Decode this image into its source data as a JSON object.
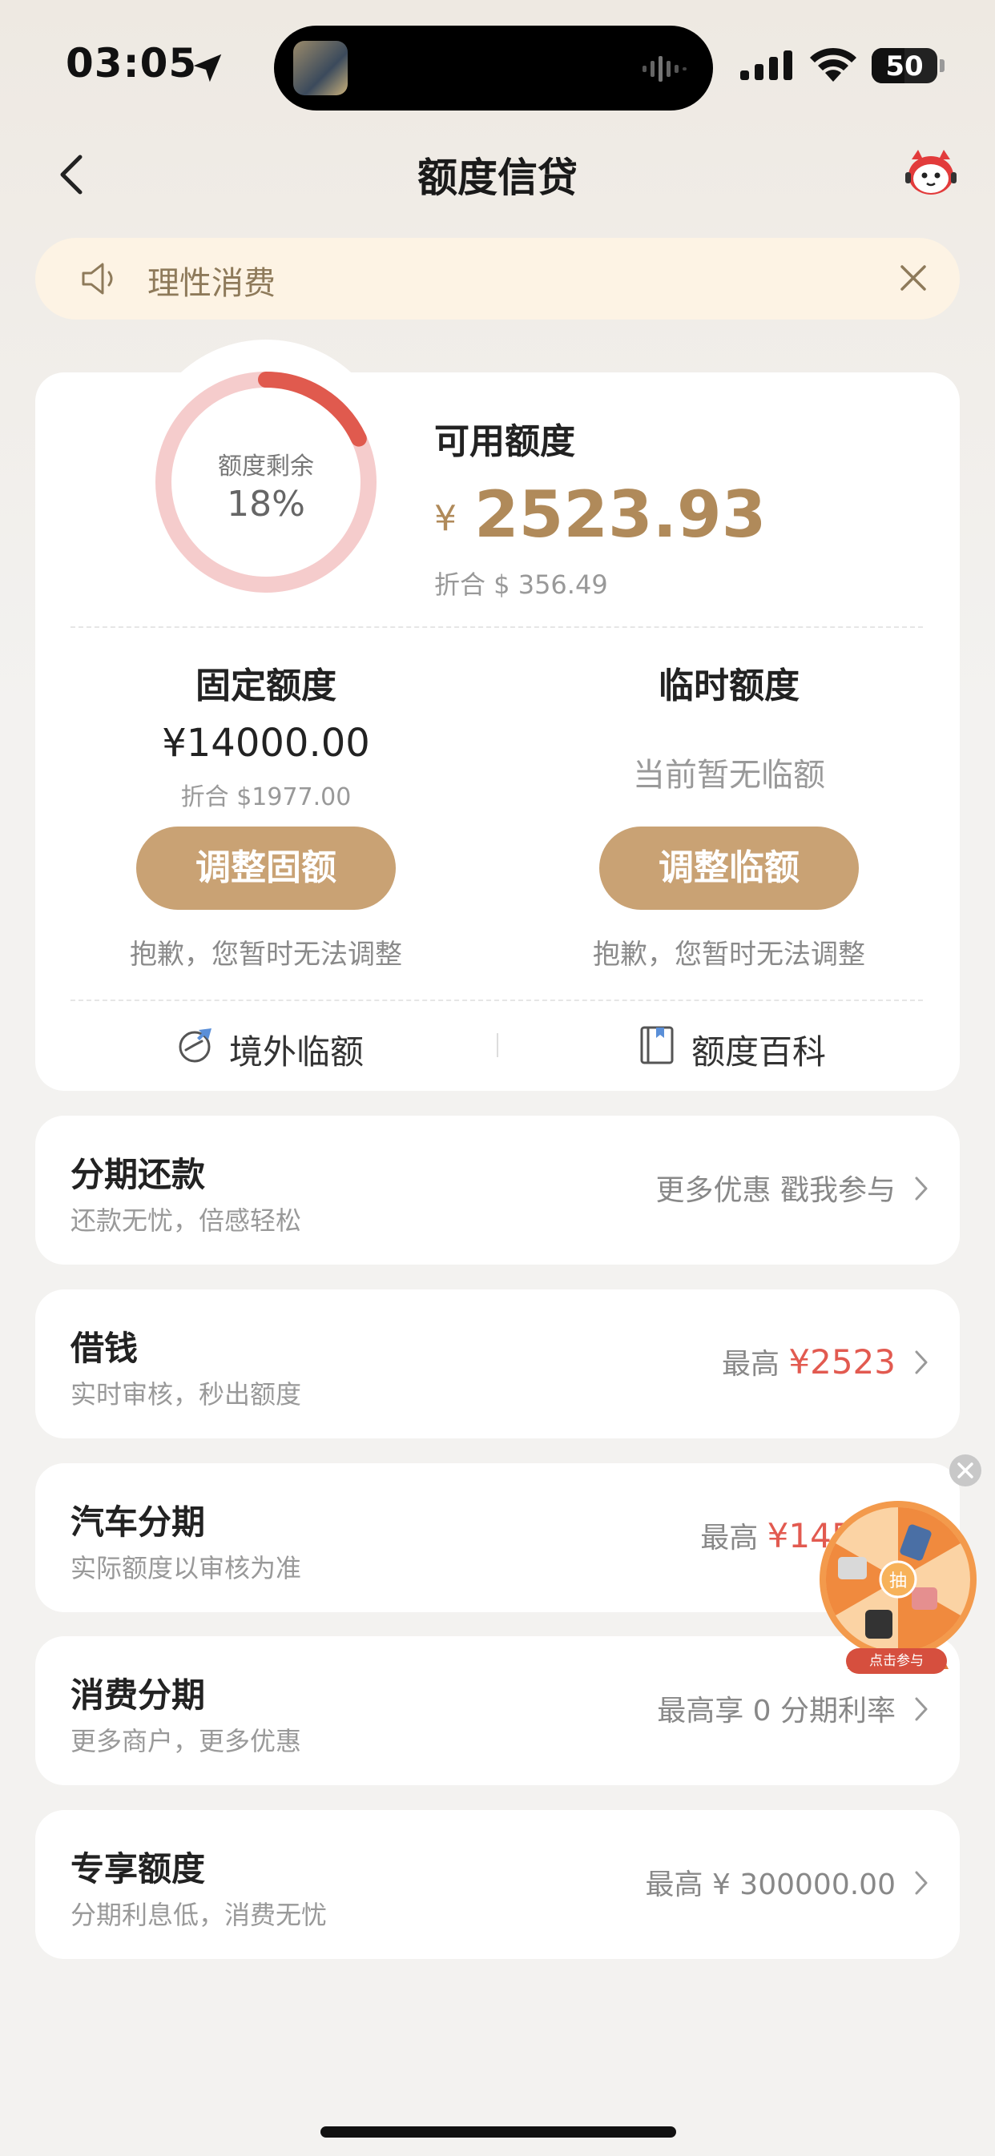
{
  "status_bar": {
    "time": "03:05",
    "battery_level": "50",
    "icons": [
      "location-arrow-icon",
      "signal-icon",
      "wifi-icon",
      "battery-icon"
    ]
  },
  "nav": {
    "title": "额度信贷",
    "back_icon": "chevron-left-icon",
    "service_icon": "customer-service-mascot-icon"
  },
  "notice": {
    "text": "理性消费",
    "icon": "speaker-icon",
    "close_icon": "close-icon"
  },
  "credit": {
    "ring_label": "额度剩余",
    "ring_percent_text": "18%",
    "ring_percent_value": 0.18,
    "available_title": "可用额度",
    "currency_symbol": "¥",
    "available_amount": "2523.93",
    "available_usd": "折合 $ 356.49",
    "fixed": {
      "title": "固定额度",
      "amount": "¥14000.00",
      "usd": "折合 $1977.00",
      "button": "调整固额",
      "note": "抱歉，您暂时无法调整"
    },
    "temporary": {
      "title": "临时额度",
      "status": "当前暂无临额",
      "button": "调整临额",
      "note": "抱歉，您暂时无法调整"
    },
    "links": [
      {
        "label": "境外临额",
        "icon": "plane-globe-icon"
      },
      {
        "label": "额度百科",
        "icon": "book-icon"
      }
    ]
  },
  "services": [
    {
      "title": "分期还款",
      "subtitle": "还款无忧，倍感轻松",
      "right_prefix": "更多优惠 戳我参与",
      "right_highlight": ""
    },
    {
      "title": "借钱",
      "subtitle": "实时审核，秒出额度",
      "right_prefix": "最高 ",
      "right_highlight": "¥2523"
    },
    {
      "title": "汽车分期",
      "subtitle": "实际额度以审核为准",
      "right_prefix": "最高 ",
      "right_highlight": "¥14500"
    },
    {
      "title": "消费分期",
      "subtitle": "更多商户，更多优惠",
      "right_prefix": "最高享 0 分期利率",
      "right_highlight": ""
    },
    {
      "title": "专享额度",
      "subtitle": "分期利息低，消费无忧",
      "right_prefix": "最高 ¥ 300000.00",
      "right_highlight": ""
    }
  ],
  "lottery": {
    "center_text": "抽",
    "label": "点击参与",
    "close_icon": "close-circle-icon"
  },
  "colors": {
    "accent_gold": "#c9a274",
    "amount_gold": "#b08a5a",
    "highlight_red": "#e25a50",
    "ring_track": "#f5cccc",
    "ring_fill": "#e05a4e",
    "notice_bg": "#fdf3e4"
  }
}
